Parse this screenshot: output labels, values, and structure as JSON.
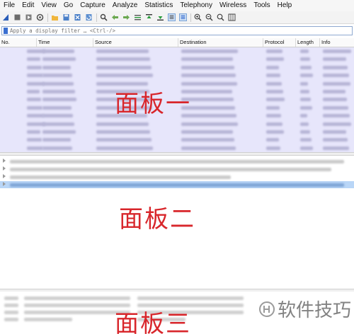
{
  "menu": [
    "File",
    "Edit",
    "View",
    "Go",
    "Capture",
    "Analyze",
    "Statistics",
    "Telephony",
    "Wireless",
    "Tools",
    "Help"
  ],
  "toolbar_icons": [
    "shark-fin-icon",
    "stop-icon",
    "restart-icon",
    "options-icon",
    "open-file-icon",
    "save-icon",
    "close-file-icon",
    "reload-icon",
    "find-icon",
    "back-icon",
    "forward-icon",
    "go-to-packet-icon",
    "first-packet-icon",
    "last-packet-icon",
    "autoscroll-icon",
    "colorize-icon",
    "zoom-in-icon",
    "zoom-out-icon",
    "zoom-normal-icon",
    "resize-columns-icon"
  ],
  "filter": {
    "placeholder": "Apply a display filter … <Ctrl-/>"
  },
  "columns": [
    "No.",
    "Time",
    "Source",
    "Destination",
    "Protocol",
    "Length",
    "Info"
  ],
  "panes": {
    "list_label": "面板一",
    "detail_label": "面板二",
    "bytes_label": "面板三"
  },
  "watermark": {
    "text": "软件技巧"
  },
  "colors": {
    "packet_list_bg": "#e7e6fb",
    "selected_row": "#b9d6f7",
    "label_red": "#d8262b"
  }
}
